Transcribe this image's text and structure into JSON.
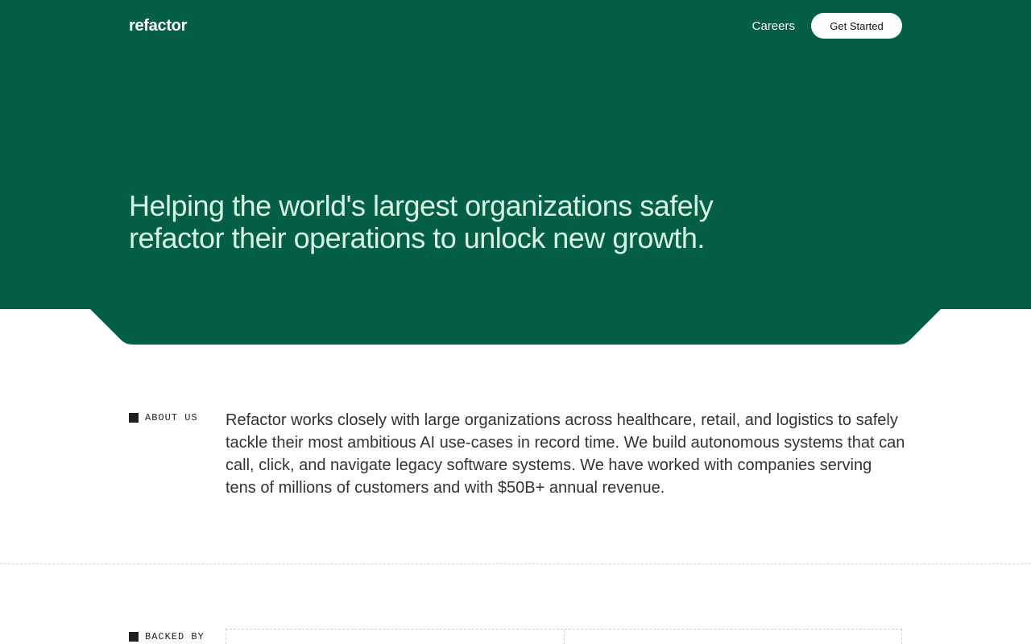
{
  "colors": {
    "hero_bg": "#055f46",
    "headline": "#d8f3e3",
    "page_bg": "#ffffff",
    "cta_bg": "#ffffff"
  },
  "header": {
    "logo": "refactor",
    "nav_link": "Careers",
    "cta_label": "Get Started"
  },
  "hero": {
    "headline_line1": "Helping the world's largest organizations safely",
    "headline_line2": "refactor their operations to unlock new growth."
  },
  "about": {
    "label": "ABOUT US",
    "text": "Refactor works closely with large organizations across healthcare, retail, and logistics to safely tackle their most ambitious AI use-cases in record time. We build autonomous systems that can call, click, and navigate legacy software systems. We have worked with companies serving tens of millions of customers and with $50B+ annual revenue."
  },
  "backed": {
    "label": "BACKED BY"
  }
}
